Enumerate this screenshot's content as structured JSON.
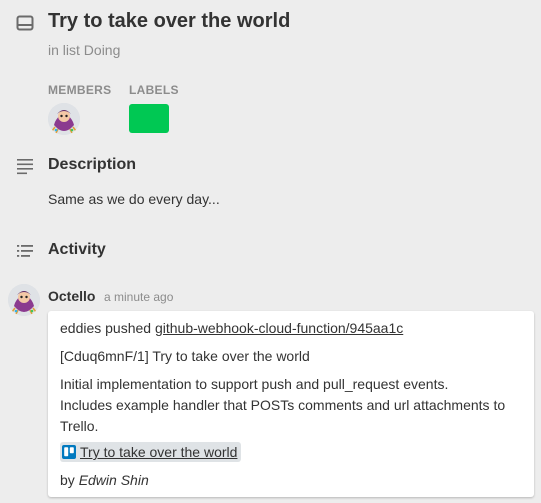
{
  "card": {
    "title": "Try to take over the world",
    "list_prefix": "in list",
    "list_name": "Doing"
  },
  "members": {
    "label": "MEMBERS"
  },
  "labels": {
    "label": "LABELS",
    "color": "#00c853"
  },
  "description": {
    "heading": "Description",
    "text": "Same as we do every day..."
  },
  "activity": {
    "heading": "Activity",
    "comment": {
      "author": "Octello",
      "time": "a minute ago",
      "pushed_prefix": "eddies pushed",
      "commit_link": "github-webhook-cloud-function/945aa1c",
      "commit_line": "[Cduq6mnF/1] Try to take over the world",
      "body_line1": "Initial implementation to support push and pull_request events.",
      "body_line2": "Includes example handler that POSTs comments and url attachments to",
      "body_line3": "Trello.",
      "attachment": "Try to take over the world",
      "by_prefix": "by",
      "by_name": "Edwin Shin"
    }
  },
  "icons": {
    "card": "card-icon",
    "description": "description-lines-icon",
    "activity": "activity-list-icon",
    "attachment": "trello-icon"
  }
}
